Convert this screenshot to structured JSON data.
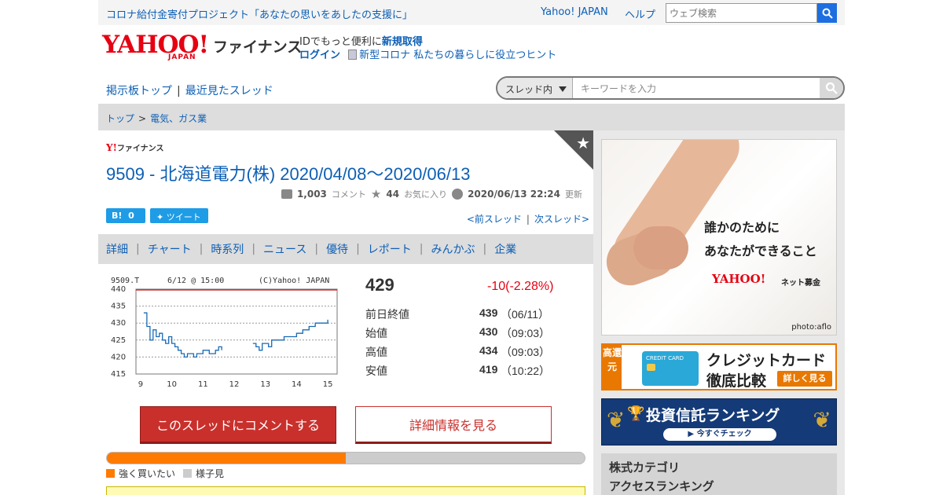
{
  "topbar": {
    "campaign": "コロナ給付金寄付プロジェクト「あなたの思いをあしたの支援に」",
    "yahoo_japan": "Yahoo! JAPAN",
    "help": "ヘルプ",
    "search_placeholder": "ウェブ検索"
  },
  "header": {
    "logo_text": "YAHOO!",
    "logo_sub": "JAPAN",
    "service": "ファイナンス",
    "id_text": "IDでもっと便利に",
    "register": "新規取得",
    "login": "ログイン",
    "covid_link": "新型コロナ 私たちの暮らしに役立つヒント"
  },
  "board_nav": {
    "board_top": "掲示板トップ",
    "recent": "最近見たスレッド",
    "search_scope": "スレッド内",
    "search_placeholder": "キーワードを入力"
  },
  "breadcrumb": {
    "top": "トップ",
    "category": "電気、ガス業"
  },
  "thread": {
    "mini_logo_y": "Y!",
    "mini_logo_text": "ファイナンス",
    "title": "9509 - 北海道電力(株) 2020/04/08〜2020/06/13",
    "comments_count": "1,003",
    "comments_label": "コメント",
    "favorites_count": "44",
    "favorites_label": "お気に入り",
    "updated": "2020/06/13 22:24",
    "updated_label": "更新",
    "hatena_label": "B!",
    "hatena_count": "0",
    "tweet_label": "ツイート",
    "prev": "<前スレッド",
    "next": "次スレッド>"
  },
  "tabs": [
    "詳細",
    "チャート",
    "時系列",
    "ニュース",
    "優待",
    "レポート",
    "みんかぶ",
    "企業"
  ],
  "chart_data": {
    "type": "line",
    "header_code": "9509.T",
    "header_time": "6/12 @ 15:00",
    "header_copy": "(C)Yahoo! JAPAN",
    "x_tick_labels": [
      "9",
      "10",
      "11",
      "12",
      "13",
      "14",
      "15"
    ],
    "y_tick_labels": [
      "440",
      "435",
      "430",
      "425",
      "420",
      "415"
    ],
    "ylim": [
      415,
      440
    ],
    "grid": true,
    "series": [
      {
        "x": [
          9.1,
          9.2,
          9.3,
          9.4,
          9.5,
          9.6,
          9.7,
          9.8,
          9.9,
          10.0,
          10.1,
          10.2,
          10.3,
          10.4,
          10.5,
          10.6,
          10.7,
          10.8,
          10.9,
          11.0,
          11.2,
          11.4,
          11.5,
          11.6,
          12.6,
          12.7,
          12.8,
          12.9,
          13.0,
          13.1,
          13.2,
          13.4,
          13.6,
          13.8,
          14.0,
          14.2,
          14.4,
          14.6,
          14.8,
          15.0
        ],
        "y": [
          433,
          429,
          425,
          428,
          426,
          427,
          425,
          424,
          426,
          424,
          423,
          422,
          421,
          420,
          421,
          421,
          420,
          421,
          421,
          422,
          421,
          422,
          423,
          422,
          424,
          423,
          422,
          424,
          424,
          423,
          425,
          425,
          426,
          426,
          427,
          428,
          429,
          430,
          430,
          431
        ]
      }
    ]
  },
  "quote": {
    "price": "429",
    "change": "-10(-2.28%)",
    "rows": [
      {
        "label": "前日終値",
        "value": "439",
        "detail": "（06/11）"
      },
      {
        "label": "始値",
        "value": "430",
        "detail": "（09:03）"
      },
      {
        "label": "高値",
        "value": "434",
        "detail": "（09:03）"
      },
      {
        "label": "安値",
        "value": "419",
        "detail": "（10:22）"
      }
    ]
  },
  "actions": {
    "comment": "このスレッドにコメントする",
    "detail": "詳細情報を見る"
  },
  "sentiment": {
    "strong_buy_label": "強く買いたい",
    "wait_label": "様子見",
    "strong_buy_fraction": 0.5,
    "strong_buy_color": "#ff7a00",
    "wait_color": "#cccccc"
  },
  "side": {
    "ad1_line1": "誰かのためにあなたができること",
    "ad1_line2": "あなたができること",
    "ad1_brand": "YAHOO!",
    "ad1_brand_sub": "ネット募金",
    "ad1_credit": "photo:aflo",
    "ad2_tag": "高還元",
    "ad2_card": "CREDIT CARD",
    "ad2_line1": "クレジットカード",
    "ad2_line2": "徹底比較",
    "ad2_more": "詳しく見る",
    "ad3_title": "投資信託ランキング",
    "ad3_cta": "▶ 今すぐチェック",
    "cat1": "株式カテゴリ",
    "cat2": "アクセスランキング"
  },
  "colors": {
    "link": "#0d5fb5",
    "brand_red": "#e60012",
    "button_red": "#c9302c"
  }
}
